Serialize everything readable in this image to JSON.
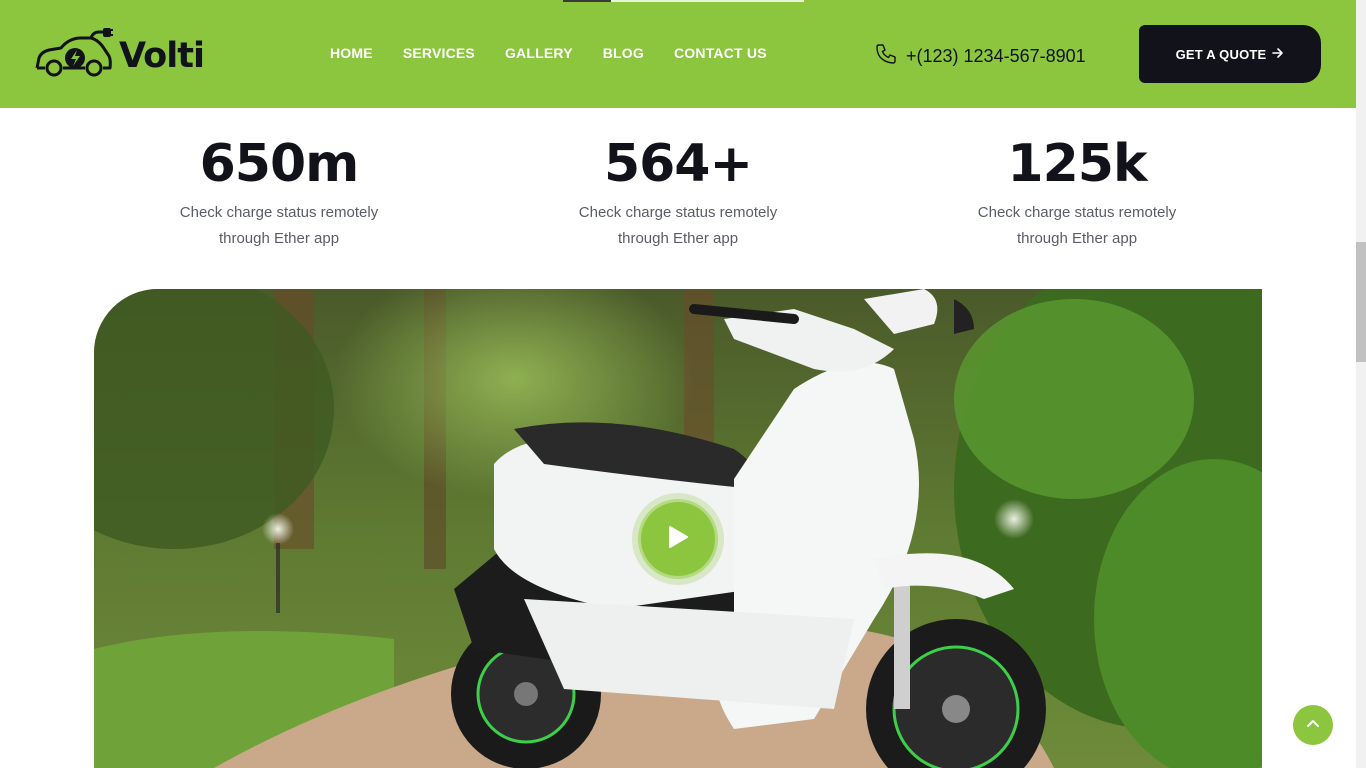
{
  "brand": {
    "name": "Volti",
    "icon": "electric-car-logo-icon"
  },
  "nav": {
    "items": [
      {
        "label": "HOME"
      },
      {
        "label": "SERVICES"
      },
      {
        "label": "GALLERY"
      },
      {
        "label": "BLOG"
      },
      {
        "label": "CONTACT US"
      }
    ]
  },
  "contact": {
    "phone": "+(123) 1234-567-8901",
    "icon": "phone-icon"
  },
  "cta": {
    "label": "GET A QUOTE",
    "icon": "arrow-right-icon"
  },
  "stats": [
    {
      "value": "650m",
      "description": "Check charge status remotely through Ether app"
    },
    {
      "value": "564+",
      "description": "Check charge status remotely through Ether app"
    },
    {
      "value": "125k",
      "description": "Check charge status remotely through Ether app"
    }
  ],
  "hero": {
    "image": "white electric scooter in a garden",
    "play_icon": "play-icon"
  },
  "scroll_top": {
    "icon": "chevron-up-icon"
  },
  "colors": {
    "brand_green": "#8cc63f",
    "dark": "#12131a",
    "text_gray": "#5a5d66"
  }
}
